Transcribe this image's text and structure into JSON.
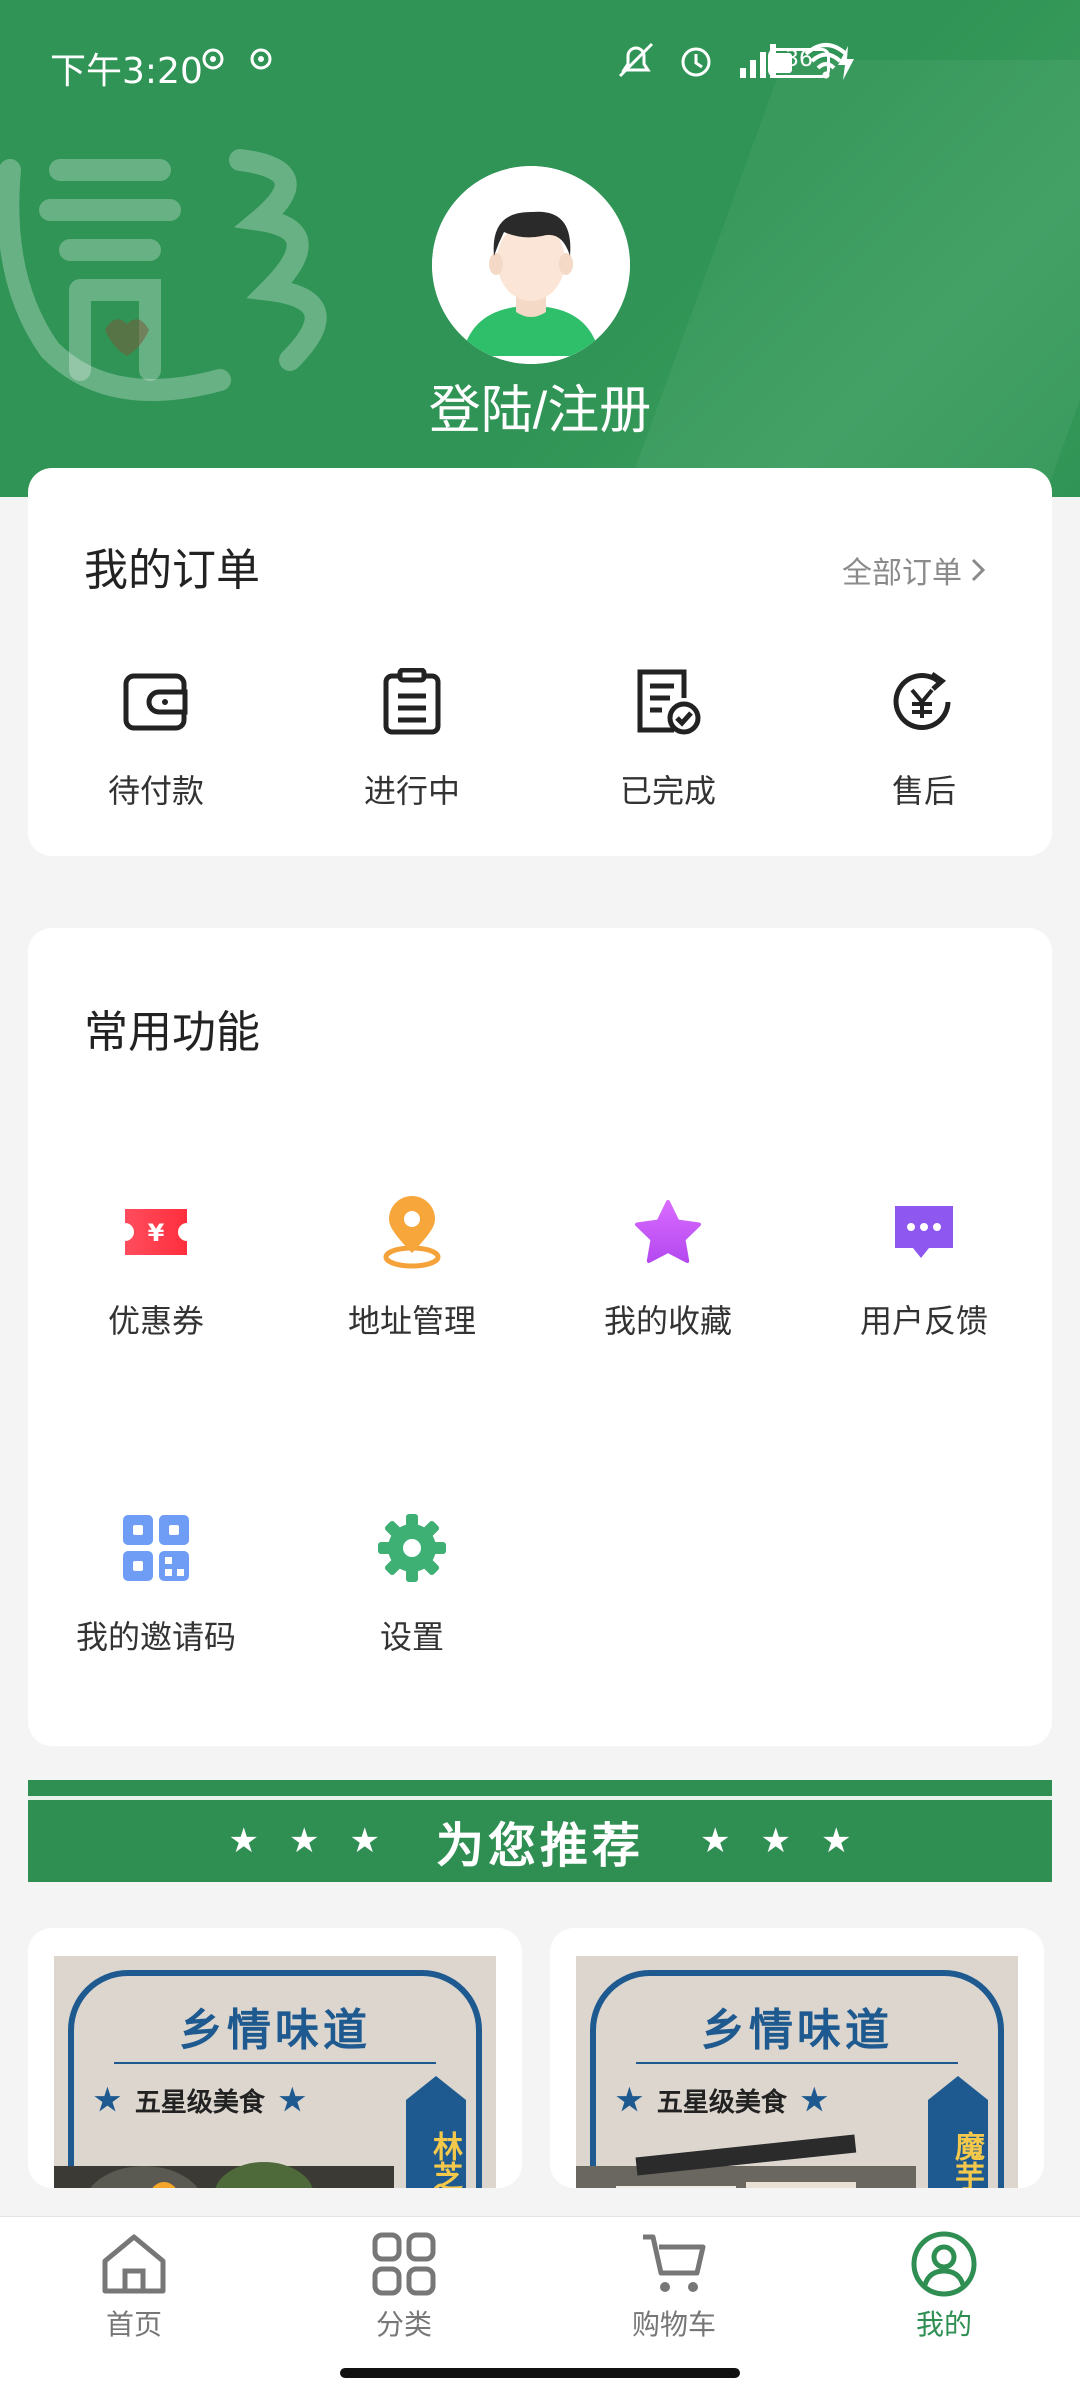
{
  "status_bar": {
    "time": "下午3:20",
    "battery": "36"
  },
  "profile": {
    "login_label": "登陆/注册"
  },
  "orders": {
    "title": "我的订单",
    "see_all": "全部订单",
    "items": [
      {
        "label": "待付款",
        "icon": "wallet-icon"
      },
      {
        "label": "进行中",
        "icon": "clipboard-icon"
      },
      {
        "label": "已完成",
        "icon": "completed-doc-icon"
      },
      {
        "label": "售后",
        "icon": "yen-refund-icon"
      }
    ]
  },
  "functions": {
    "title": "常用功能",
    "items": [
      {
        "label": "优惠券",
        "icon": "coupon-icon"
      },
      {
        "label": "地址管理",
        "icon": "location-pin-icon"
      },
      {
        "label": "我的收藏",
        "icon": "star-icon"
      },
      {
        "label": "用户反馈",
        "icon": "chat-bubble-icon"
      },
      {
        "label": "我的邀请码",
        "icon": "qr-code-icon"
      },
      {
        "label": "设置",
        "icon": "gear-icon"
      }
    ]
  },
  "recommend": {
    "banner_text": "为您推荐"
  },
  "products": [
    {
      "title": "乡情味道",
      "subtitle": "五星级美食",
      "tag": "林芝金耳"
    },
    {
      "title": "乡情味道",
      "subtitle": "五星级美食",
      "tag": "魔芋豆腐"
    }
  ],
  "bottom_nav": {
    "items": [
      {
        "label": "首页",
        "icon": "home-icon"
      },
      {
        "label": "分类",
        "icon": "category-grid-icon"
      },
      {
        "label": "购物车",
        "icon": "cart-icon"
      },
      {
        "label": "我的",
        "icon": "profile-icon"
      }
    ],
    "active_index": 3
  },
  "colors": {
    "brand_green": "#2f9455",
    "active_nav": "#2f8f52",
    "poster_blue": "#1e5a8f"
  }
}
